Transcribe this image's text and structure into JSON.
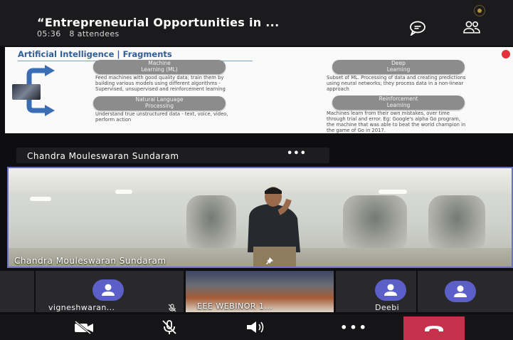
{
  "meeting": {
    "title": "“Entrepreneurial Opportunities in ...",
    "duration": "05:36",
    "attendees": "8 attendees"
  },
  "slide": {
    "title": "Artificial Intelligence | Fragments",
    "blocks": [
      {
        "heading1": "Machine",
        "heading2": "Learning (ML)",
        "text": "Feed machines with good quality data; train them by building various models using different algorithms - Supervised, unsupervised and reinforcement learning"
      },
      {
        "heading1": "Natural Language",
        "heading2": "Processing",
        "text": "Understand true unstructured data - text, voice, video, perform action"
      },
      {
        "heading1": "Deep",
        "heading2": "Learning",
        "text": "Subset of ML. Processing of data and creating predictions using neural networks; they process data in a non-linear approach"
      },
      {
        "heading1": "Reinforcement",
        "heading2": "Learning",
        "text": "Machines learn from their own mistakes, over time through trial and error. Eg: Google's alpha Go program, the machine that was able to beat the world champion in the game of Go in 2017."
      }
    ]
  },
  "speaker": {
    "name": "Chandra Mouleswaran Sundaram",
    "more": "•••"
  },
  "video": {
    "name": "Chandra Mouleswaran Sundaram"
  },
  "participants": [
    {
      "name": "vigneshwaran..."
    },
    {
      "name": "EEE WEBINOR 1..."
    },
    {
      "name": "Deebi"
    }
  ],
  "controls": {
    "more": "•••"
  },
  "colors": {
    "avatar": "#5b5fc7",
    "end_call": "#c4314b",
    "video_border": "#6c6fc8"
  }
}
